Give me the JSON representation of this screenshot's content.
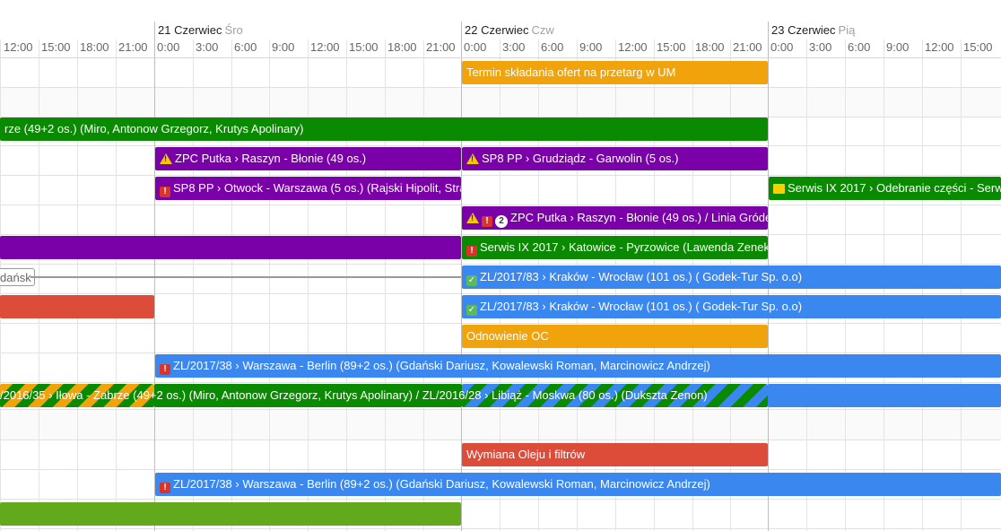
{
  "calendar": {
    "days": [
      {
        "date": "21 Czerwiec",
        "weekday": "Śro"
      },
      {
        "date": "22 Czerwiec",
        "weekday": "Czw"
      },
      {
        "date": "23 Czerwiec",
        "weekday": "Pią"
      }
    ],
    "hours": {
      "lead": [
        "12:00",
        "15:00",
        "18:00",
        "21:00"
      ],
      "day1": [
        "0:00",
        "3:00",
        "6:00",
        "9:00",
        "12:00",
        "15:00",
        "18:00",
        "21:00"
      ],
      "day2": [
        "0:00",
        "3:00",
        "6:00",
        "9:00",
        "12:00",
        "15:00",
        "18:00",
        "21:00"
      ],
      "day3": [
        "0:00",
        "3:00",
        "6:00",
        "9:00",
        "12:00",
        "15:00"
      ]
    }
  },
  "colors": {
    "orange": "#f0a30a",
    "green": "#0a8a00",
    "purple": "#7a00a8",
    "red": "#dd4b39",
    "blue": "#3a87f0",
    "lime": "#62a91c"
  },
  "events": {
    "e01": {
      "label": "Termin składania ofert na przetarg w UM"
    },
    "e02": {
      "label": "rze (49+2 os.) (Miro, Antonow Grzegorz, Krutys Apolinary)"
    },
    "e03": {
      "label": "ZPC Putka › Raszyn - Błonie (49 os.)",
      "icons": [
        "warning-icon"
      ]
    },
    "e04": {
      "label": "SP8 PP › Grudziądz - Garwolin (5 os.)",
      "icons": [
        "warning-icon"
      ]
    },
    "e05": {
      "label": "SP8 PP › Otwock - Warszawa (5 os.) (Rajski Hipolit, Stram",
      "icons": [
        "alert-icon"
      ]
    },
    "e06": {
      "label": "Serwis IX 2017 › Odebranie części - Serwis",
      "icons": [
        "note-icon"
      ]
    },
    "e07": {
      "label": "ZPC Putka › Raszyn - Błonie (49 os.) / Linia Gróde",
      "count": "2",
      "icons": [
        "warning-icon",
        "alert-icon"
      ]
    },
    "e08": {
      "label": ""
    },
    "e09": {
      "label": "Serwis IX 2017 › Katowice - Pyrzowice (Lawenda Zenek",
      "icons": [
        "alert-icon"
      ]
    },
    "e10": {
      "label": "dańsk"
    },
    "e11": {
      "label": "ZL/2017/83 › Kraków - Wrocław (101 os.) ( Godek-Tur Sp. o.o)",
      "icons": [
        "ok-icon"
      ]
    },
    "e12": {
      "label": ""
    },
    "e13": {
      "label": "ZL/2017/83 › Kraków - Wrocław (101 os.) ( Godek-Tur Sp. o.o)",
      "icons": [
        "ok-icon"
      ]
    },
    "e14": {
      "label": "Odnowienie OC"
    },
    "e15": {
      "label": "ZL/2017/38 › Warszawa - Berlin (89+2 os.) (Gdański Dariusz, Kowalewski Roman, Marcinowicz Andrzej)",
      "icons": [
        "alert-icon"
      ]
    },
    "e16": {
      "label": "/2016/35 › Iłowa - Zabrze (49+2 os.) (Miro, Antonow Grzegorz, Krutys Apolinary) / ZL/2016/28 › Libiąż - Moskwa (80 os.) (Dukszta Zenon)"
    },
    "e17": {
      "label": "Wymiana Oleju i filtrów"
    },
    "e18": {
      "label": "ZL/2017/38 › Warszawa - Berlin (89+2 os.) (Gdański Dariusz, Kowalewski Roman, Marcinowicz Andrzej)",
      "icons": [
        "alert-icon"
      ]
    },
    "e19": {
      "label": ""
    }
  }
}
